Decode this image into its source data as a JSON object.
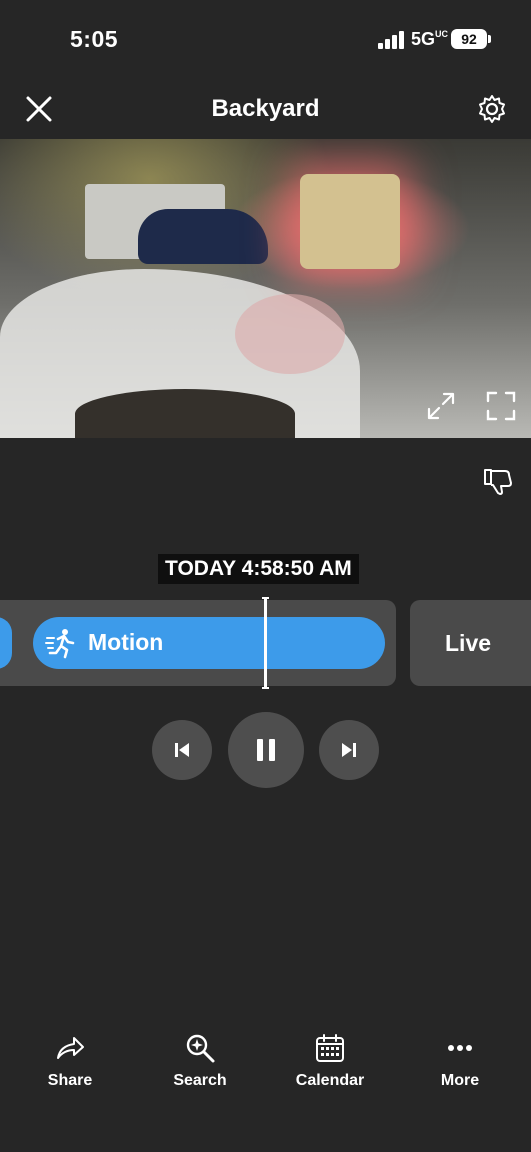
{
  "status_bar": {
    "time": "5:05",
    "network": "5G",
    "network_sub": "UC",
    "battery": "92"
  },
  "header": {
    "title": "Backyard",
    "close_icon": "close-icon",
    "settings_icon": "gear-icon"
  },
  "video": {
    "expand_icon": "expand-arrows-icon",
    "fullscreen_icon": "fullscreen-icon"
  },
  "feedback_icon": "thumbs-down-icon",
  "timeline": {
    "timestamp": "TODAY 4:58:50 AM",
    "event_label": "Motion",
    "live_label": "Live",
    "event_color": "#3d9bea"
  },
  "controls": {
    "prev_icon": "skip-back-icon",
    "pause_icon": "pause-icon",
    "next_icon": "skip-forward-icon"
  },
  "toolbar": {
    "share": "Share",
    "search": "Search",
    "calendar": "Calendar",
    "more": "More"
  }
}
